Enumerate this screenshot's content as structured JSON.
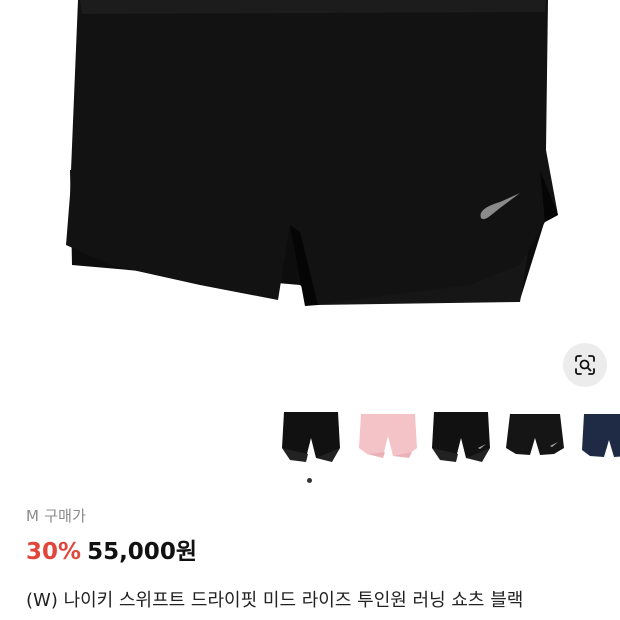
{
  "product": {
    "title": "(W) 나이키 스위프트 드라이핏 미드 라이즈 투인원 러닝 쇼츠 블랙",
    "buy_label": "M 구매가",
    "discount": "30%",
    "price": "55,000원"
  },
  "thumbnails": [
    {
      "color_name": "black"
    },
    {
      "color_name": "pink"
    },
    {
      "color_name": "black"
    },
    {
      "color_name": "black"
    },
    {
      "color_name": "navy"
    }
  ],
  "colors": {
    "discount": "#e0463b",
    "price": "#111111",
    "label": "#8b8b8b",
    "shorts": "#111111",
    "pink": "#f4c3c8",
    "navy": "#1f2a44"
  },
  "icons": [
    "image-search-icon",
    "swoosh-icon"
  ],
  "carousel": {
    "active_index": 1,
    "dot_count": 1
  }
}
